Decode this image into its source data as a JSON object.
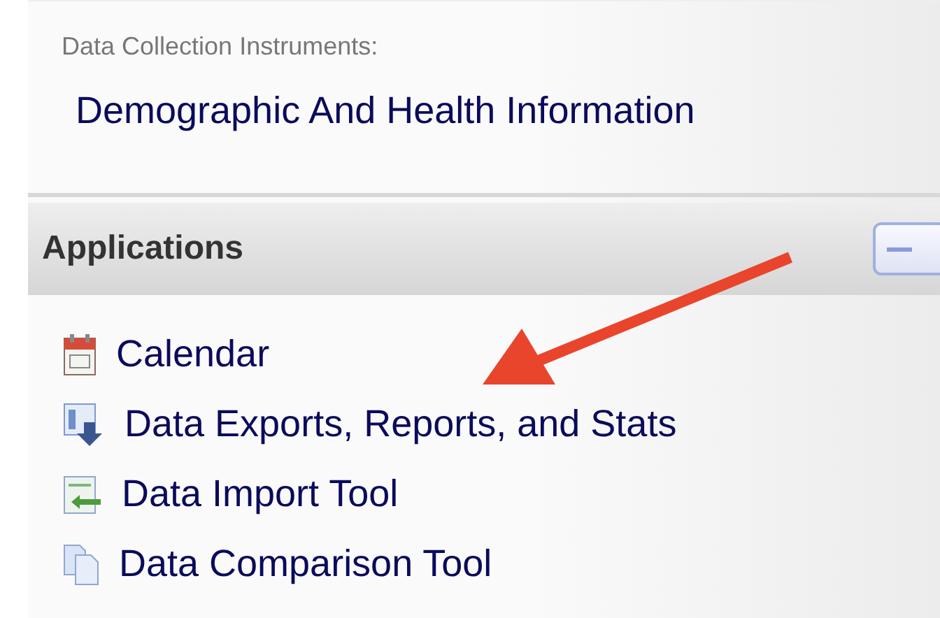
{
  "instruments": {
    "label": "Data Collection Instruments:",
    "links": [
      "Demographic And Health Information"
    ]
  },
  "applications": {
    "title": "Applications",
    "expanded": true,
    "items": [
      {
        "kind": "calendar",
        "label": "Calendar"
      },
      {
        "kind": "export",
        "label": "Data Exports, Reports, and Stats"
      },
      {
        "kind": "import",
        "label": "Data Import Tool"
      },
      {
        "kind": "compare",
        "label": "Data Comparison Tool"
      }
    ]
  }
}
